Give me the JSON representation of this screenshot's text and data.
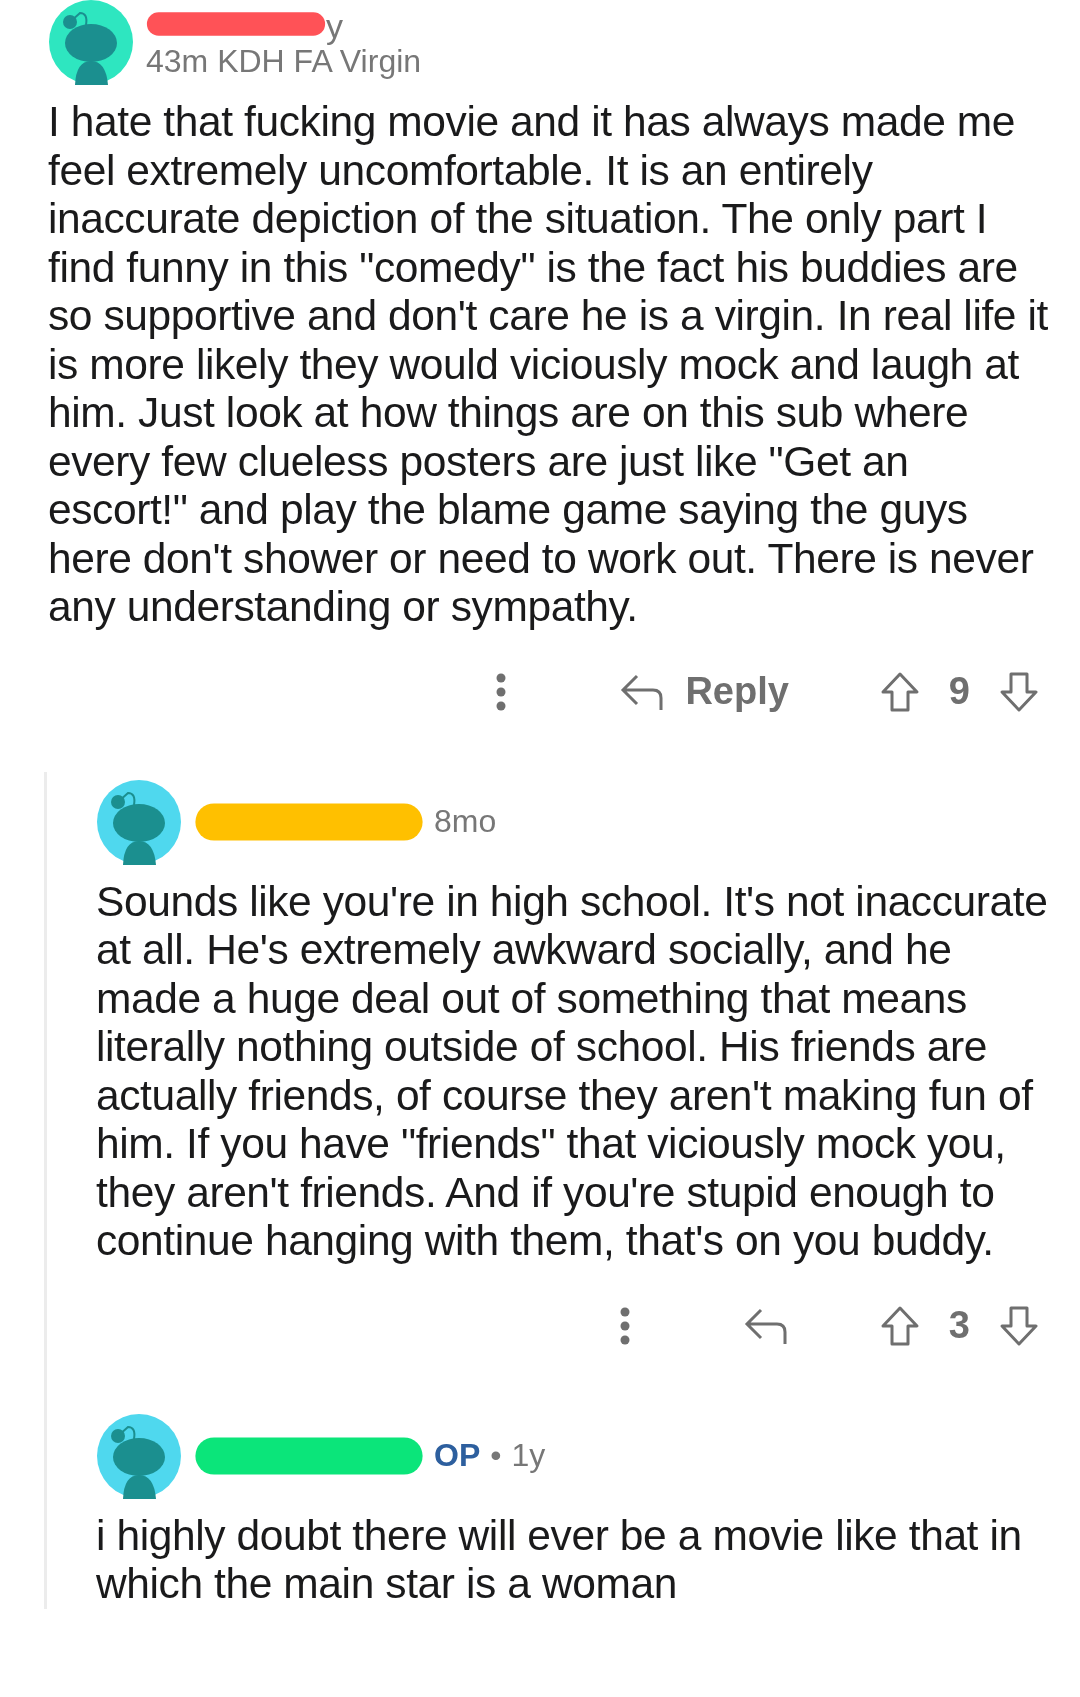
{
  "comments": [
    {
      "color": "#2ee6c0",
      "redaction": {
        "color": "#ff5257"
      },
      "username": "y",
      "meta": "43m KDH FA Virgin",
      "op": false,
      "body": "I hate that fucking movie and it has always made me feel extremely uncomfortable. It is an entirely inaccurate depiction of the situation. The only part I find funny in this \"comedy\" is the fact his buddies are so supportive and don't care he is a virgin. In real life it is more likely they would viciously mock and laugh at him. Just look at how things are on this sub where every few clueless posters are just like \"Get an escort!\" and play the blame game saying the guys here don't shower or need to work out. There is never any understanding or sympathy.",
      "reply_label": "Reply",
      "score": "9",
      "children": [
        {
          "color": "#4fd8ee",
          "redaction": {
            "color": "#ffc000"
          },
          "meta": "8mo",
          "op": false,
          "body": "Sounds like you're in high school. It's not inaccurate at all. He's extremely awkward socially, and he made a huge deal out of something that means literally nothing outside of school. His friends are actually friends, of course they aren't making fun of him. If you have \"friends\" that viciously mock you, they aren't friends. And if you're stupid enough to continue hanging with them, that's on you buddy.",
          "score": "3"
        },
        {
          "color": "#4fd8ee",
          "redaction": {
            "color": "#0be57a"
          },
          "op_label": "OP",
          "dot": "•",
          "meta": "1y",
          "op": true,
          "body": "i highly doubt there will ever be a movie like that in which the main star is a woman"
        }
      ]
    }
  ]
}
